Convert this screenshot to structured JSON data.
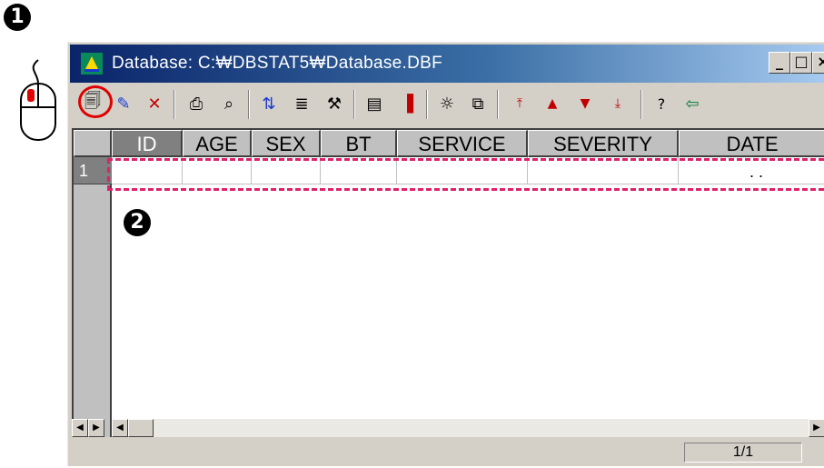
{
  "steps": {
    "first": "1",
    "second": "2"
  },
  "window": {
    "title": "Database: C:₩DBSTAT5₩Database.DBF",
    "buttons": {
      "minimize": "_",
      "maximize": "□",
      "close": "×"
    }
  },
  "toolbar": {
    "icons": [
      "new-record-icon",
      "edit-icon",
      "delete-icon",
      "print-icon",
      "find-icon",
      "sort-icon",
      "format-icon",
      "tools-icon",
      "window-icon",
      "chart-icon",
      "analysis-icon",
      "copy-icon",
      "first-record-icon",
      "previous-record-icon",
      "next-record-icon",
      "last-record-icon",
      "help-icon",
      "exit-icon"
    ],
    "glyphs": [
      "🗐",
      "✎",
      "✕",
      "⎙",
      "⌕",
      "⇅",
      "≣",
      "⚒",
      "▤",
      "▐",
      "☼",
      "⧉",
      "⤒",
      "▲",
      "▼",
      "⤓",
      "?",
      "⇦"
    ],
    "highlight_color": "#e00000"
  },
  "grid": {
    "columns": [
      "ID",
      "AGE",
      "SEX",
      "BT",
      "SERVICE",
      "SEVERITY",
      "DATE"
    ],
    "rows": [
      {
        "number": "1",
        "date": ". ."
      }
    ],
    "selection_color": "#e0206a"
  },
  "status": {
    "page": "1/1"
  }
}
